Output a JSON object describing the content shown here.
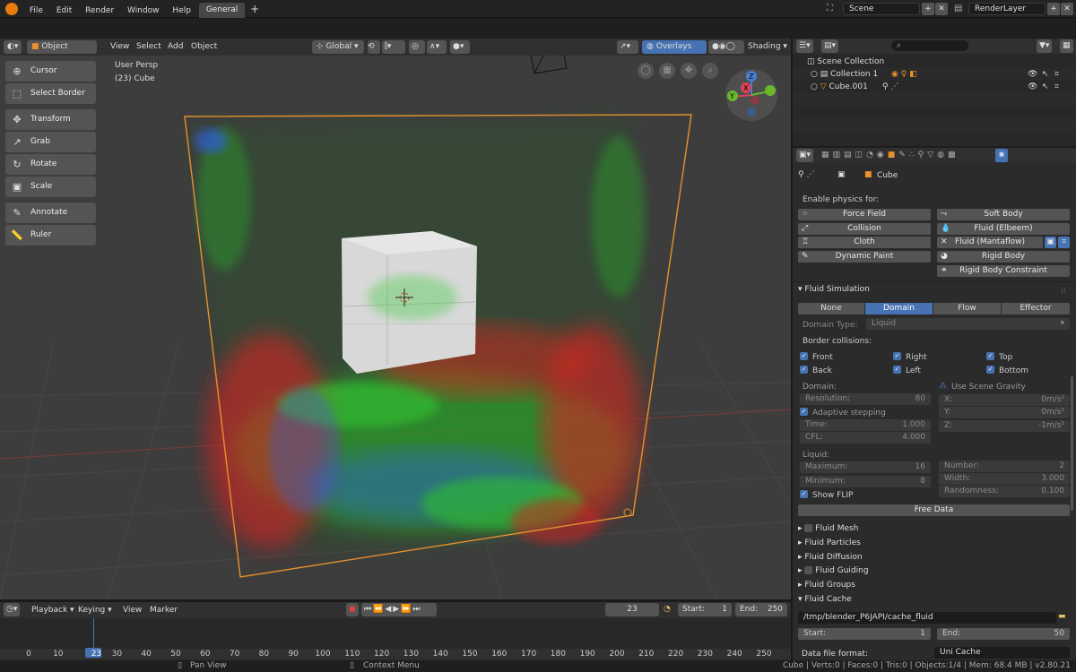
{
  "topbar": {
    "menus": [
      "File",
      "Edit",
      "Render",
      "Window",
      "Help"
    ],
    "workspace_tab": "General",
    "add_tab": "+",
    "scene": "Scene",
    "render_layer": "RenderLayer"
  },
  "viewport_header": {
    "mode": "Object Mode",
    "menus": [
      "View",
      "Select",
      "Add",
      "Object"
    ],
    "transform_orientation": "Global",
    "overlays": "Overlays",
    "shading": "Shading"
  },
  "viewport": {
    "view_label": "User Persp",
    "object_label": "(23) Cube"
  },
  "toolbar": {
    "cursor": "Cursor",
    "select_border": "Select Border",
    "transform": "Transform",
    "grab": "Grab",
    "rotate": "Rotate",
    "scale": "Scale",
    "annotate": "Annotate",
    "ruler": "Ruler"
  },
  "navigation_gizmo": {
    "z": "Z",
    "y": "Y",
    "x": "X"
  },
  "outliner": {
    "scene_collection": "Scene Collection",
    "collection": "Collection 1",
    "object": "Cube.001"
  },
  "properties": {
    "object_name": "Cube",
    "enable_physics_label": "Enable physics for:",
    "physics_left": [
      "Force Field",
      "Collision",
      "Cloth",
      "Dynamic Paint"
    ],
    "physics_right": [
      "Soft Body",
      "Fluid (Elbeem)",
      "Fluid (Mantaflow)",
      "Rigid Body",
      "Rigid Body Constraint"
    ],
    "fluid_simulation": "Fluid Simulation",
    "fluid_tabs": [
      "None",
      "Domain",
      "Flow",
      "Effector"
    ],
    "domain_type_label": "Domain Type:",
    "domain_type_value": "Liquid",
    "border_collisions_label": "Border collisions:",
    "border": {
      "front": "Front",
      "right": "Right",
      "top": "Top",
      "back": "Back",
      "left": "Left",
      "bottom": "Bottom"
    },
    "domain_label": "Domain:",
    "use_scene_gravity": "Use Scene Gravity",
    "resolution": {
      "label": "Resolution:",
      "value": "80"
    },
    "adaptive_stepping": "Adaptive stepping",
    "time": {
      "label": "Time:",
      "value": "1.000"
    },
    "cfl": {
      "label": "CFL:",
      "value": "4.000"
    },
    "gravity_x": {
      "label": "X:",
      "value": "0m/s²"
    },
    "gravity_y": {
      "label": "Y:",
      "value": "0m/s²"
    },
    "gravity_z": {
      "label": "Z:",
      "value": "-1m/s²"
    },
    "liquid_label": "Liquid:",
    "maximum": {
      "label": "Maximum:",
      "value": "16"
    },
    "minimum": {
      "label": "Minimum:",
      "value": "8"
    },
    "number": {
      "label": "Number:",
      "value": "2"
    },
    "width": {
      "label": "Width:",
      "value": "3.000"
    },
    "randomness": {
      "label": "Randomness:",
      "value": "0.100"
    },
    "show_flip": "Show FLIP",
    "free_data": "Free Data",
    "subpanels": [
      "Fluid Mesh",
      "Fluid Particles",
      "Fluid Diffusion",
      "Fluid Guiding",
      "Fluid Groups",
      "Fluid Cache"
    ],
    "cache_path": "/tmp/blender_P6JAPI/cache_fluid",
    "cache_start": {
      "label": "Start:",
      "value": "1"
    },
    "cache_end": {
      "label": "End:",
      "value": "50"
    },
    "data_file_format_label": "Data file format:",
    "data_file_format_value": "Uni Cache"
  },
  "timeline": {
    "menus": [
      "Playback",
      "Keying",
      "View",
      "Marker"
    ],
    "current_frame": "23",
    "start_label": "Start:",
    "start_value": "1",
    "end_label": "End:",
    "end_value": "250",
    "ticks": [
      "0",
      "10",
      "23",
      "30",
      "40",
      "50",
      "60",
      "70",
      "80",
      "90",
      "100",
      "110",
      "120",
      "130",
      "140",
      "150",
      "160",
      "170",
      "180",
      "190",
      "200",
      "210",
      "220",
      "230",
      "240",
      "250"
    ]
  },
  "statusbar": {
    "pan_view": "Pan View",
    "context_menu": "Context Menu",
    "stats": "Cube | Verts:0 | Faces:0 | Tris:0 | Objects:1/4 | Mem: 68.4 MB | v2.80.21"
  },
  "colors": {
    "accent": "#4772b3",
    "bbox_orange": "#e8912d",
    "particles_green": "#3dd23d",
    "particles_red": "#e01e1e",
    "particles_blue": "#2f5fd8"
  }
}
